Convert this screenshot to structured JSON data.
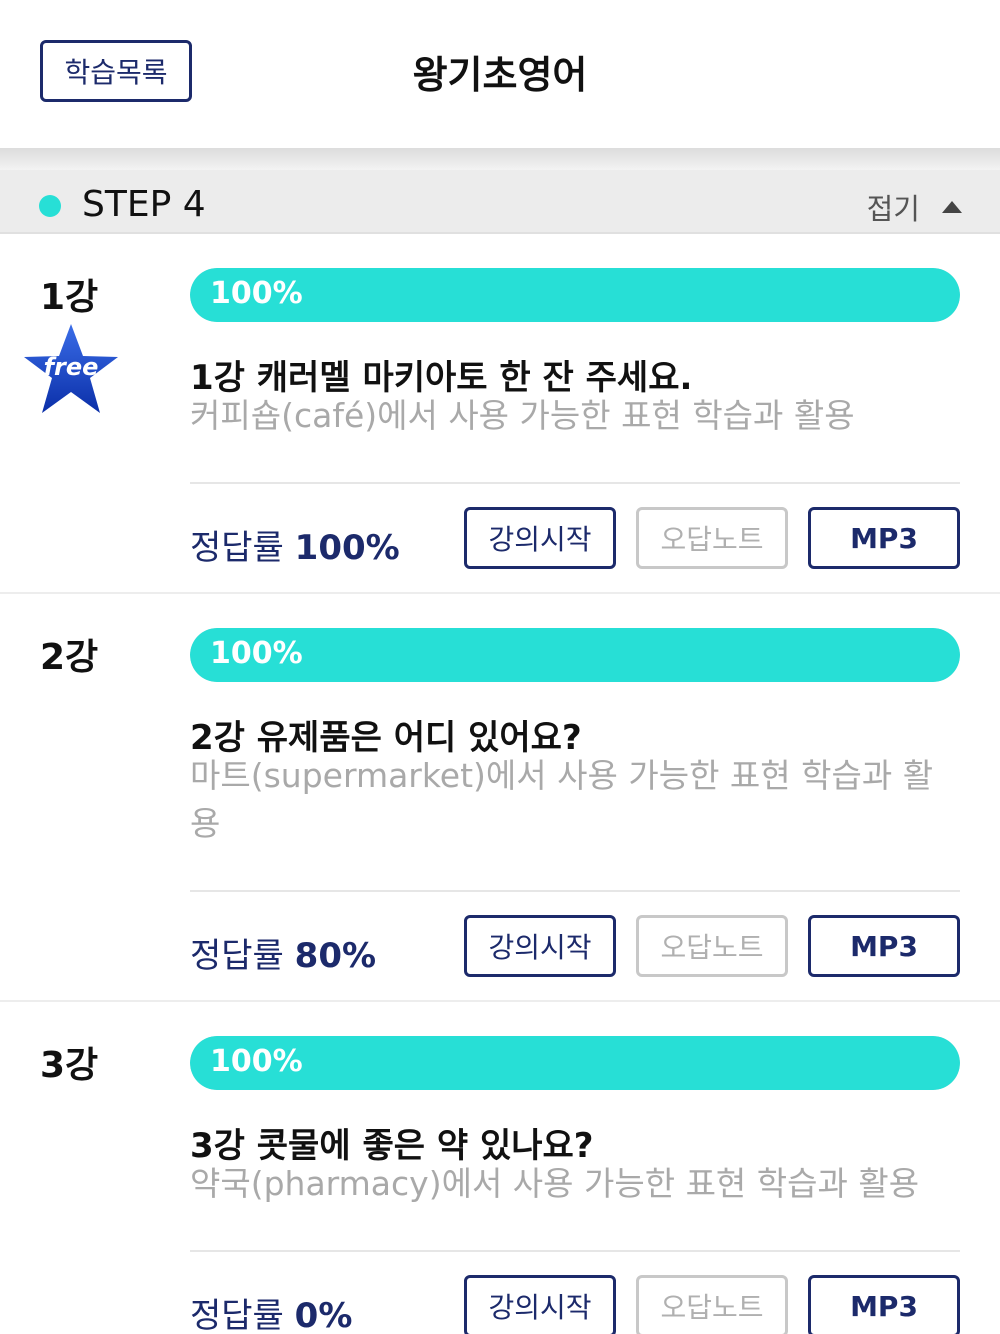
{
  "header": {
    "back_label": "학습목록",
    "title": "왕기초영어"
  },
  "step": {
    "label": "STEP 4",
    "collapse_label": "접기",
    "dot_color": "#27dfd6"
  },
  "colors": {
    "accent": "#27dfd6",
    "navy": "#1c2a6b",
    "muted": "#a9a9a9"
  },
  "lectures": [
    {
      "number": "1강",
      "free_label": "free",
      "progress": 100,
      "progress_label": "100%",
      "title": "1강 캐러멜 마키아토 한 잔 주세요.",
      "description": "커피숍(café)에서 사용 가능한 표현 학습과 활용",
      "rate_label": "정답률",
      "rate_value": "100%",
      "start_label": "강의시작",
      "note_label": "오답노트",
      "mp3_label": "MP3"
    },
    {
      "number": "2강",
      "progress": 100,
      "progress_label": "100%",
      "title": "2강 유제품은 어디 있어요?",
      "description": "마트(supermarket)에서 사용 가능한 표현 학습과 활용",
      "rate_label": "정답률",
      "rate_value": "80%",
      "start_label": "강의시작",
      "note_label": "오답노트",
      "mp3_label": "MP3"
    },
    {
      "number": "3강",
      "progress": 100,
      "progress_label": "100%",
      "title": "3강 콧물에 좋은 약 있나요?",
      "description": "약국(pharmacy)에서 사용 가능한 표현 학습과 활용",
      "rate_label": "정답률",
      "rate_value": "0%",
      "start_label": "강의시작",
      "note_label": "오답노트",
      "mp3_label": "MP3"
    }
  ]
}
